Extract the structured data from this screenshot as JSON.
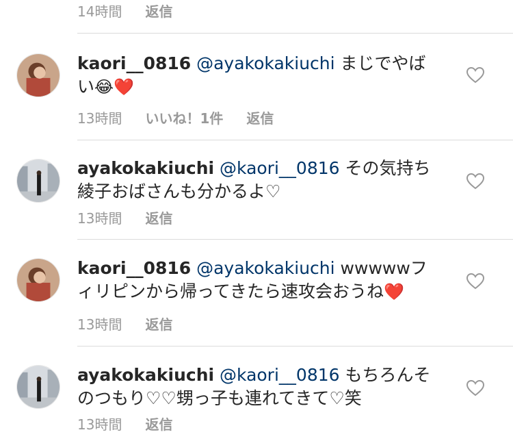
{
  "top": {
    "time": "14時間",
    "reply": "返信"
  },
  "comments": [
    {
      "username": "kaori__0816",
      "mention": "@ayakokakiuchi",
      "text": "まじでやばい",
      "emoji1": "😂",
      "emoji2": "❤️",
      "time": "13時間",
      "likes": "いいね！1件",
      "reply": "返信"
    },
    {
      "username": "ayakokakiuchi",
      "mention": "@kaori__0816",
      "text": "その気持ち綾子おばさんも分かるよ♡",
      "time": "13時間",
      "reply": "返信"
    },
    {
      "username": "kaori__0816",
      "mention": "@ayakokakiuchi",
      "text": "wwwwwフィリピンから帰ってきたら速攻会おうね",
      "emoji1": "❤️",
      "time": "13時間",
      "reply": "返信"
    },
    {
      "username": "ayakokakiuchi",
      "mention": "@kaori__0816",
      "text": "もちろんそのつもり♡♡甥っ子も連れてきて♡笑",
      "time": "13時間",
      "reply": "返信"
    }
  ],
  "colors": {
    "text": "#262626",
    "mention": "#003569",
    "meta": "#999999",
    "divider": "#dbdbdb"
  }
}
